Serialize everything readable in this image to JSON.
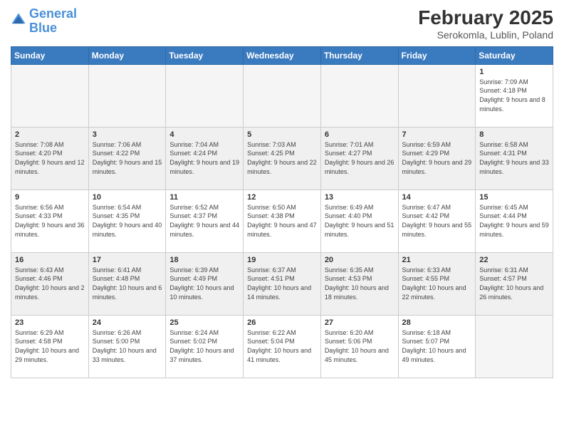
{
  "logo": {
    "line1": "General",
    "line2": "Blue"
  },
  "title": "February 2025",
  "subtitle": "Serokomla, Lublin, Poland",
  "days_of_week": [
    "Sunday",
    "Monday",
    "Tuesday",
    "Wednesday",
    "Thursday",
    "Friday",
    "Saturday"
  ],
  "weeks": [
    {
      "shaded": false,
      "days": [
        {
          "num": "",
          "info": ""
        },
        {
          "num": "",
          "info": ""
        },
        {
          "num": "",
          "info": ""
        },
        {
          "num": "",
          "info": ""
        },
        {
          "num": "",
          "info": ""
        },
        {
          "num": "",
          "info": ""
        },
        {
          "num": "1",
          "info": "Sunrise: 7:09 AM\nSunset: 4:18 PM\nDaylight: 9 hours and 8 minutes."
        }
      ]
    },
    {
      "shaded": true,
      "days": [
        {
          "num": "2",
          "info": "Sunrise: 7:08 AM\nSunset: 4:20 PM\nDaylight: 9 hours and 12 minutes."
        },
        {
          "num": "3",
          "info": "Sunrise: 7:06 AM\nSunset: 4:22 PM\nDaylight: 9 hours and 15 minutes."
        },
        {
          "num": "4",
          "info": "Sunrise: 7:04 AM\nSunset: 4:24 PM\nDaylight: 9 hours and 19 minutes."
        },
        {
          "num": "5",
          "info": "Sunrise: 7:03 AM\nSunset: 4:25 PM\nDaylight: 9 hours and 22 minutes."
        },
        {
          "num": "6",
          "info": "Sunrise: 7:01 AM\nSunset: 4:27 PM\nDaylight: 9 hours and 26 minutes."
        },
        {
          "num": "7",
          "info": "Sunrise: 6:59 AM\nSunset: 4:29 PM\nDaylight: 9 hours and 29 minutes."
        },
        {
          "num": "8",
          "info": "Sunrise: 6:58 AM\nSunset: 4:31 PM\nDaylight: 9 hours and 33 minutes."
        }
      ]
    },
    {
      "shaded": false,
      "days": [
        {
          "num": "9",
          "info": "Sunrise: 6:56 AM\nSunset: 4:33 PM\nDaylight: 9 hours and 36 minutes."
        },
        {
          "num": "10",
          "info": "Sunrise: 6:54 AM\nSunset: 4:35 PM\nDaylight: 9 hours and 40 minutes."
        },
        {
          "num": "11",
          "info": "Sunrise: 6:52 AM\nSunset: 4:37 PM\nDaylight: 9 hours and 44 minutes."
        },
        {
          "num": "12",
          "info": "Sunrise: 6:50 AM\nSunset: 4:38 PM\nDaylight: 9 hours and 47 minutes."
        },
        {
          "num": "13",
          "info": "Sunrise: 6:49 AM\nSunset: 4:40 PM\nDaylight: 9 hours and 51 minutes."
        },
        {
          "num": "14",
          "info": "Sunrise: 6:47 AM\nSunset: 4:42 PM\nDaylight: 9 hours and 55 minutes."
        },
        {
          "num": "15",
          "info": "Sunrise: 6:45 AM\nSunset: 4:44 PM\nDaylight: 9 hours and 59 minutes."
        }
      ]
    },
    {
      "shaded": true,
      "days": [
        {
          "num": "16",
          "info": "Sunrise: 6:43 AM\nSunset: 4:46 PM\nDaylight: 10 hours and 2 minutes."
        },
        {
          "num": "17",
          "info": "Sunrise: 6:41 AM\nSunset: 4:48 PM\nDaylight: 10 hours and 6 minutes."
        },
        {
          "num": "18",
          "info": "Sunrise: 6:39 AM\nSunset: 4:49 PM\nDaylight: 10 hours and 10 minutes."
        },
        {
          "num": "19",
          "info": "Sunrise: 6:37 AM\nSunset: 4:51 PM\nDaylight: 10 hours and 14 minutes."
        },
        {
          "num": "20",
          "info": "Sunrise: 6:35 AM\nSunset: 4:53 PM\nDaylight: 10 hours and 18 minutes."
        },
        {
          "num": "21",
          "info": "Sunrise: 6:33 AM\nSunset: 4:55 PM\nDaylight: 10 hours and 22 minutes."
        },
        {
          "num": "22",
          "info": "Sunrise: 6:31 AM\nSunset: 4:57 PM\nDaylight: 10 hours and 26 minutes."
        }
      ]
    },
    {
      "shaded": false,
      "days": [
        {
          "num": "23",
          "info": "Sunrise: 6:29 AM\nSunset: 4:58 PM\nDaylight: 10 hours and 29 minutes."
        },
        {
          "num": "24",
          "info": "Sunrise: 6:26 AM\nSunset: 5:00 PM\nDaylight: 10 hours and 33 minutes."
        },
        {
          "num": "25",
          "info": "Sunrise: 6:24 AM\nSunset: 5:02 PM\nDaylight: 10 hours and 37 minutes."
        },
        {
          "num": "26",
          "info": "Sunrise: 6:22 AM\nSunset: 5:04 PM\nDaylight: 10 hours and 41 minutes."
        },
        {
          "num": "27",
          "info": "Sunrise: 6:20 AM\nSunset: 5:06 PM\nDaylight: 10 hours and 45 minutes."
        },
        {
          "num": "28",
          "info": "Sunrise: 6:18 AM\nSunset: 5:07 PM\nDaylight: 10 hours and 49 minutes."
        },
        {
          "num": "",
          "info": ""
        }
      ]
    }
  ]
}
